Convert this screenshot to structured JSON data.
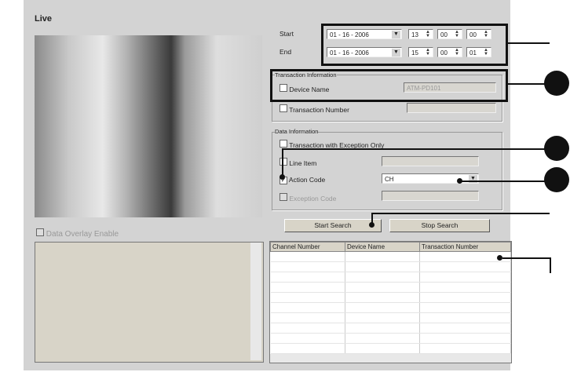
{
  "title": "Live",
  "time": {
    "start_label": "Start",
    "end_label": "End",
    "start": {
      "date": "01 - 16 - 2006",
      "hour": "13",
      "minute": "00",
      "second": "00"
    },
    "end": {
      "date": "01 - 16 - 2006",
      "hour": "15",
      "minute": "00",
      "second": "01"
    }
  },
  "transaction": {
    "group_label": "Transaction Information",
    "device_name_label": "Device Name",
    "device_name_value": "ATM-PD101",
    "device_name_checked": false,
    "transaction_number_label": "Transaction Number",
    "transaction_number_value": ""
  },
  "data_info": {
    "group_label": "Data Information",
    "exception_only_label": "Transaction with Exception Only",
    "line_item_label": "Line Item",
    "action_code_label": "Action Code",
    "action_code_checked": true,
    "action_code_value": "CH",
    "exception_code_label": "Exception Code"
  },
  "buttons": {
    "start_search": "Start Search",
    "stop_search": "Stop Search"
  },
  "overlay": {
    "label": "Data Overlay Enable"
  },
  "results": {
    "columns": [
      "Channel Number",
      "Device Name",
      "Transaction Number"
    ]
  },
  "icons": {
    "dropdown": "chevron-down-icon",
    "spinner": "spinner-icon",
    "callout": "callout-marker"
  }
}
